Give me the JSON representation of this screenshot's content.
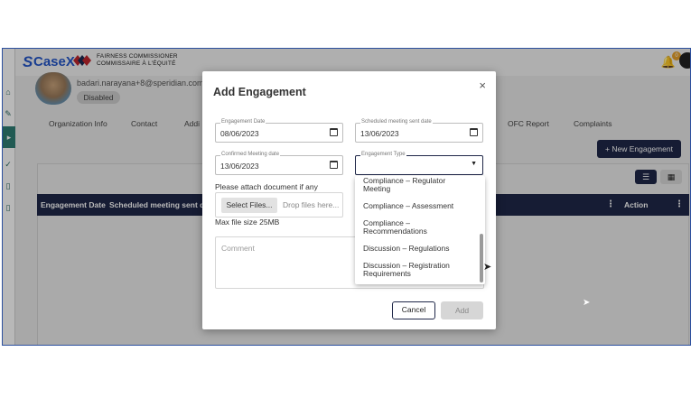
{
  "app": {
    "logo": "CaseX",
    "org_line1": "FAIRNESS COMMISSIONER",
    "org_line2": "COMMISSAIRE À L'ÉQUITÉ",
    "notification_count": "0"
  },
  "profile": {
    "email": "badari.narayana+8@speridian.com",
    "status": "Disabled"
  },
  "tabs": [
    "Organization Info",
    "Contact",
    "Addi",
    "OFC Report",
    "Complaints"
  ],
  "actions": {
    "new_engagement": "+ New Engagement"
  },
  "table": {
    "headers": [
      "Engagement Date",
      "Scheduled meeting sent date",
      "Action"
    ]
  },
  "modal": {
    "title": "Add Engagement",
    "close": "×",
    "engagement_date": {
      "label": "Engagement Date",
      "value": "08/06/2023"
    },
    "scheduled_date": {
      "label": "Scheduled meeting sent date",
      "value": "13/06/2023"
    },
    "confirmed_date": {
      "label": "Confirmed Meeting date",
      "value": "13/06/2023"
    },
    "engagement_type": {
      "label": "Engagement Type",
      "value": ""
    },
    "attach_label": "Please attach document if any",
    "select_files": "Select Files...",
    "drop_hint": "Drop files here...",
    "max_size": "Max file size 25MB",
    "comment_placeholder": "Comment",
    "cancel": "Cancel",
    "add": "Add"
  },
  "engagement_type_options": [
    "Compliance – Regulator Meeting",
    "Compliance – Assessment",
    "Compliance – Recommendations",
    "Discussion – Regulations",
    "Discussion – Registration Requirements"
  ]
}
